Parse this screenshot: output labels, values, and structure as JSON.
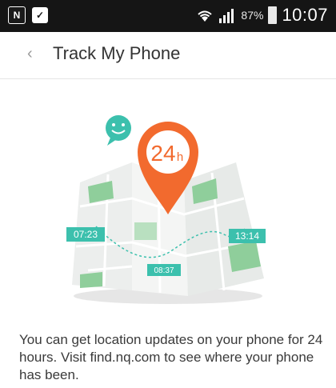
{
  "status_bar": {
    "left_icons": [
      "notification-n-icon",
      "clipboard-check-icon"
    ],
    "n_glyph": "N",
    "battery_percent": "87%",
    "time": "10:07",
    "icons": [
      "wifi-icon",
      "signal-icon",
      "battery-icon"
    ]
  },
  "app_bar": {
    "back_glyph": "‹",
    "title": "Track My Phone"
  },
  "illustration": {
    "pin_label": "24",
    "pin_unit": "h",
    "times": [
      "07:23",
      "13:14",
      "08:37"
    ],
    "colors": {
      "pin": "#f26a2e",
      "teal": "#3cc0ad",
      "map_green": "#8fce9b",
      "map_gray": "#e9ecea"
    }
  },
  "description": "You can get location updates on your phone for 24 hours. Visit find.nq.com to see where your phone has been."
}
